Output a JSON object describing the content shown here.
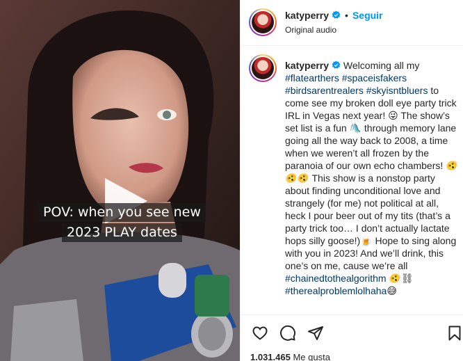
{
  "post_header": {
    "username": "katyperry",
    "separator": "•",
    "follow_label": "Seguir",
    "audio_label": "Original audio"
  },
  "video": {
    "overlay_line1": "POV: when you see new",
    "overlay_line2": "2023 PLAY dates"
  },
  "caption": {
    "username": "katyperry",
    "segments": [
      " Welcoming all my ",
      "#flatearthers",
      " ",
      "#spaceisfakers",
      " ",
      "#birdsarentrealers",
      " ",
      "#skyisntbluers",
      " to come see my broken doll eye party trick IRL in Vegas next year! 😜 The show’s set list is a fun 🛝 through memory lane going all the way back to 2008, a time when we weren’t all frozen by the paranoia of our own echo chambers! 🫨🫨🫨 This show is a nonstop party about finding unconditional love and strangely (for me) not political at all, heck I pour beer out of my tits (that’s a party trick too… I don’t actually lactate hops silly goose!)🍺 Hope to sing along with you in 2023! And we’ll drink, this one’s on me, cause we’re all ",
      "#chainedtothealgorithm",
      " 🫨⛓ ",
      "#therealproblemlolhaha",
      "😅"
    ]
  },
  "actions": {
    "like_icon": "heart-icon",
    "comment_icon": "comment-icon",
    "share_icon": "send-icon",
    "save_icon": "bookmark-icon"
  },
  "likes": {
    "count": "1.031.465",
    "label": " Me gusta"
  },
  "colors": {
    "link": "#0095f6",
    "hashtag": "#00376b",
    "text": "#262626",
    "border": "#efefef"
  }
}
